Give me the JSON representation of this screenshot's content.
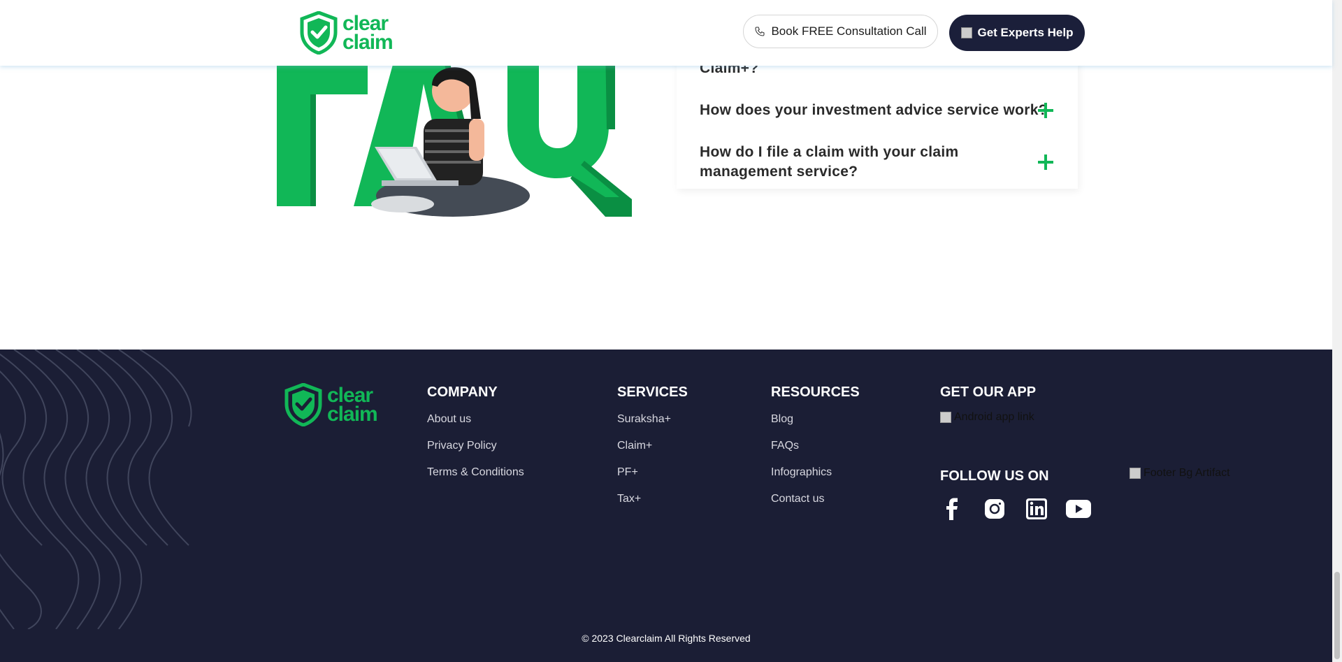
{
  "header": {
    "logo_line1": "clear",
    "logo_line2": "claim",
    "consult_label": "Book FREE Consultation Call",
    "experts_label": "Get Experts Help"
  },
  "faq": {
    "items": [
      {
        "question": "Claim+?"
      },
      {
        "question": "How does your investment advice service work?"
      },
      {
        "question": "How do I file a claim with your claim management service?"
      }
    ]
  },
  "footer": {
    "logo_line1": "clear",
    "logo_line2": "claim",
    "company": {
      "title": "COMPANY",
      "links": [
        "About us",
        "Privacy Policy",
        "Terms & Conditions"
      ]
    },
    "services": {
      "title": "SERVICES",
      "links": [
        "Suraksha+",
        "Claim+",
        "PF+",
        "Tax+"
      ]
    },
    "resources": {
      "title": "RESOURCES",
      "links": [
        "Blog",
        "FAQs",
        "Infographics",
        "Contact us"
      ]
    },
    "app": {
      "title": "GET OUR APP",
      "android_alt": "Android app link"
    },
    "follow_title": "FOLLOW US ON",
    "social_icons": [
      "facebook-icon",
      "instagram-icon",
      "linkedin-icon",
      "youtube-icon"
    ],
    "bg_artifact_alt": "Footer Bg Artifact",
    "copyright": "© 2023 Clearclaim All Rights Reserved"
  },
  "colors": {
    "brand_green": "#11b757",
    "footer_navy": "#1b1e35",
    "button_navy": "#1b1f3a"
  }
}
